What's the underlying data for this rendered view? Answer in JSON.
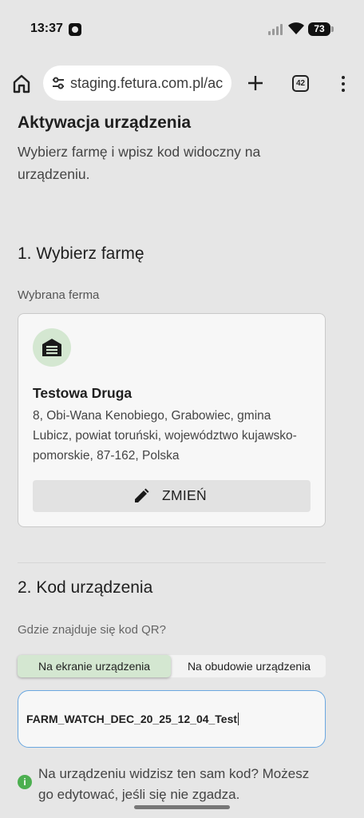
{
  "status_bar": {
    "time": "13:37",
    "battery": "73",
    "icons": [
      "app-notification-icon",
      "signal-icon",
      "wifi-icon",
      "battery-icon"
    ]
  },
  "browser": {
    "url": "staging.fetura.com.pl/ac",
    "tab_count": "42",
    "icons": [
      "home-icon",
      "site-settings-icon",
      "new-tab-plus-icon",
      "tabs-icon",
      "overflow-menu-icon"
    ]
  },
  "page": {
    "title": "Aktywacja urządzenia",
    "subtitle": "Wybierz farmę i wpisz kod widoczny na urządzeniu."
  },
  "step1": {
    "title": "1. Wybierz farmę",
    "selected_label": "Wybrana ferma",
    "farm": {
      "icon": "barn-icon",
      "name": "Testowa Druga",
      "address": "8, Obi-Wana Kenobiego, Grabowiec, gmina Lubicz, powiat toruński, województwo kujawsko-pomorskie, 87-162, Polska"
    },
    "change_button": {
      "icon": "pencil-icon",
      "label": "ZMIEŃ"
    }
  },
  "step2": {
    "title": "2. Kod urządzenia",
    "qr_question": "Gdzie znajduje się kod QR?",
    "options": [
      "Na ekranie urządzenia",
      "Na obudowie urządzenia"
    ],
    "selected_option": "Na ekranie urządzenia",
    "code_value": "FARM_WATCH_DEC_20_25_12_04_Test",
    "info_icon": "info-icon",
    "info_text": "Na urządzeniu widzisz ten sam kod? Możesz go edytować, jeśli się nie zgadza."
  },
  "colors": {
    "background": "#e6e6e6",
    "accent_green": "#d4e7d1",
    "focus_blue": "#6aa7e0",
    "info_green": "#4caf50"
  }
}
